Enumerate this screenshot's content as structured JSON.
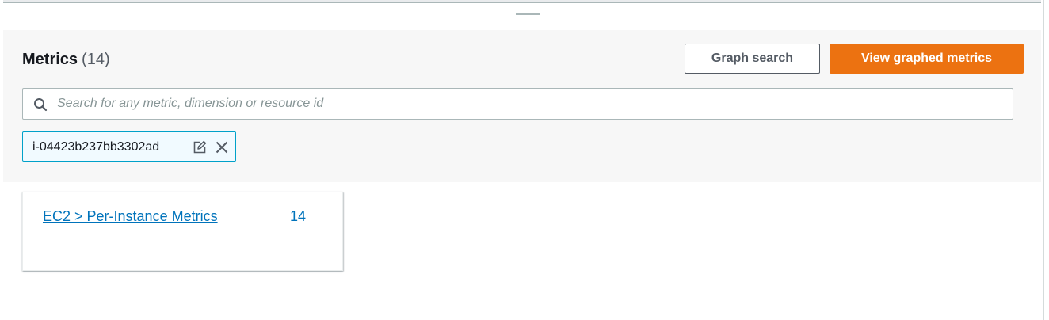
{
  "metrics": {
    "title": "Metrics",
    "count": "(14)"
  },
  "toolbar": {
    "graph_search_label": "Graph search",
    "view_graphed_label": "View graphed metrics"
  },
  "search": {
    "placeholder": "Search for any metric, dimension or resource id",
    "value": ""
  },
  "filter_token": {
    "label": "i-04423b237bb3302ad",
    "edit_icon": "edit-icon",
    "remove_icon": "close-icon"
  },
  "namespace_cards": [
    {
      "label": "EC2 > Per-Instance Metrics",
      "count": "14"
    }
  ],
  "colors": {
    "primary_button": "#ec7211",
    "link": "#0073bb",
    "token_border": "#00a1c9",
    "token_background": "#f1faff"
  }
}
